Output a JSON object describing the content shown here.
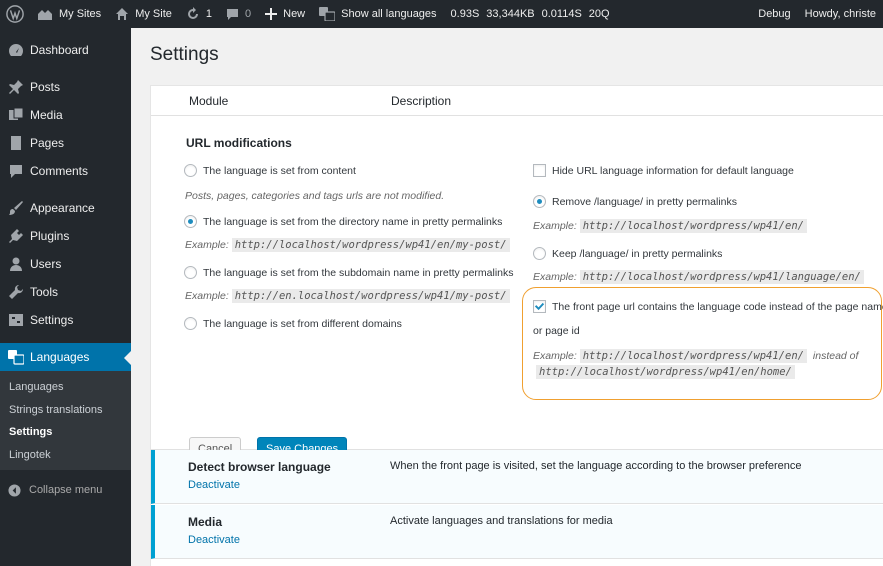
{
  "adminbar": {
    "my_sites": "My Sites",
    "my_site": "My Site",
    "updates_count": "1",
    "comments_count": "0",
    "new_label": "New",
    "show_all_languages": "Show all languages",
    "perf_time": "0.93S",
    "perf_memory": "33,344KB",
    "perf_query_time": "0.0114S",
    "perf_queries": "20Q",
    "debug": "Debug",
    "howdy": "Howdy, christe"
  },
  "sidebar": {
    "items": [
      {
        "label": "Dashboard",
        "icon": "dashboard-icon"
      },
      {
        "label": "Posts",
        "icon": "pin-icon"
      },
      {
        "label": "Media",
        "icon": "media-icon"
      },
      {
        "label": "Pages",
        "icon": "page-icon"
      },
      {
        "label": "Comments",
        "icon": "comment-icon"
      },
      {
        "label": "Appearance",
        "icon": "brush-icon"
      },
      {
        "label": "Plugins",
        "icon": "plug-icon"
      },
      {
        "label": "Users",
        "icon": "user-icon"
      },
      {
        "label": "Tools",
        "icon": "wrench-icon"
      },
      {
        "label": "Settings",
        "icon": "settings-icon"
      },
      {
        "label": "Languages",
        "icon": "translation-icon"
      }
    ],
    "submenu": [
      "Languages",
      "Strings translations",
      "Settings",
      "Lingotek"
    ],
    "collapse": "Collapse menu"
  },
  "page": {
    "title": "Settings",
    "col_module": "Module",
    "col_description": "Description"
  },
  "url_mod": {
    "heading": "URL modifications",
    "opt_content": "The language is set from content",
    "note_content": "Posts, pages, categories and tags urls are not modified.",
    "opt_directory": "The language is set from the directory name in pretty permalinks",
    "example_label": "Example:",
    "ex_directory": "http://localhost/wordpress/wp41/en/my-post/",
    "opt_subdomain": "The language is set from the subdomain name in pretty permalinks",
    "ex_subdomain": "http://en.localhost/wordpress/wp41/my-post/",
    "opt_domains": "The language is set from different domains",
    "opt_hide_default": "Hide URL language information for default language",
    "opt_remove": "Remove /language/ in pretty permalinks",
    "ex_remove": "http://localhost/wordpress/wp41/en/",
    "opt_keep": "Keep /language/ in pretty permalinks",
    "ex_keep": "http://localhost/wordpress/wp41/language/en/",
    "opt_front_line1": "The front page url contains the language code instead of the page name",
    "opt_front_line2": "or page id",
    "ex_front_a": "http://localhost/wordpress/wp41/en/",
    "instead_of": "instead of",
    "ex_front_b": "http://localhost/wordpress/wp41/en/home/"
  },
  "buttons": {
    "cancel": "Cancel",
    "save": "Save Changes"
  },
  "modules": [
    {
      "name": "Detect browser language",
      "action": "Deactivate",
      "description": "When the front page is visited, set the language according to the browser preference"
    },
    {
      "name": "Media",
      "action": "Deactivate",
      "description": "Activate languages and translations for media"
    }
  ],
  "colors": {
    "accent": "#0073aa",
    "highlight_border": "#f0a030",
    "admin_bar_bg": "#23282d"
  }
}
